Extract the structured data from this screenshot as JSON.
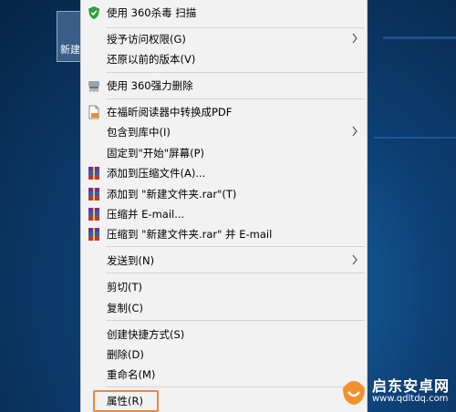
{
  "desktop": {
    "icon_label": "新建"
  },
  "menu": {
    "items": [
      {
        "label": "使用 360杀毒 扫描",
        "icon": "shield-360-icon"
      },
      {
        "label": "授予访问权限(G)",
        "submenu": true
      },
      {
        "label": "还原以前的版本(V)"
      },
      {
        "label": "使用 360强力删除",
        "icon": "shredder-icon"
      },
      {
        "label": "在福昕阅读器中转换成PDF",
        "icon": "pdf-convert-icon"
      },
      {
        "label": "包含到库中(I)",
        "submenu": true
      },
      {
        "label": "固定到\"开始\"屏幕(P)"
      },
      {
        "label": "添加到压缩文件(A)...",
        "icon": "winrar-icon"
      },
      {
        "label": "添加到 \"新建文件夹.rar\"(T)",
        "icon": "winrar-icon"
      },
      {
        "label": "压缩并 E-mail...",
        "icon": "winrar-icon"
      },
      {
        "label": "压缩到 \"新建文件夹.rar\" 并 E-mail",
        "icon": "winrar-icon"
      },
      {
        "label": "发送到(N)",
        "submenu": true
      },
      {
        "label": "剪切(T)"
      },
      {
        "label": "复制(C)"
      },
      {
        "label": "创建快捷方式(S)"
      },
      {
        "label": "删除(D)"
      },
      {
        "label": "重命名(M)"
      },
      {
        "label": "属性(R)",
        "highlighted": true
      }
    ]
  },
  "watermark": {
    "title": "启东安卓网",
    "url": "www.qdltdq.com"
  },
  "colors": {
    "menu_bg": "#f2f2f2",
    "highlight_border": "#f0883a",
    "desktop_bg": "#0d3f73"
  }
}
